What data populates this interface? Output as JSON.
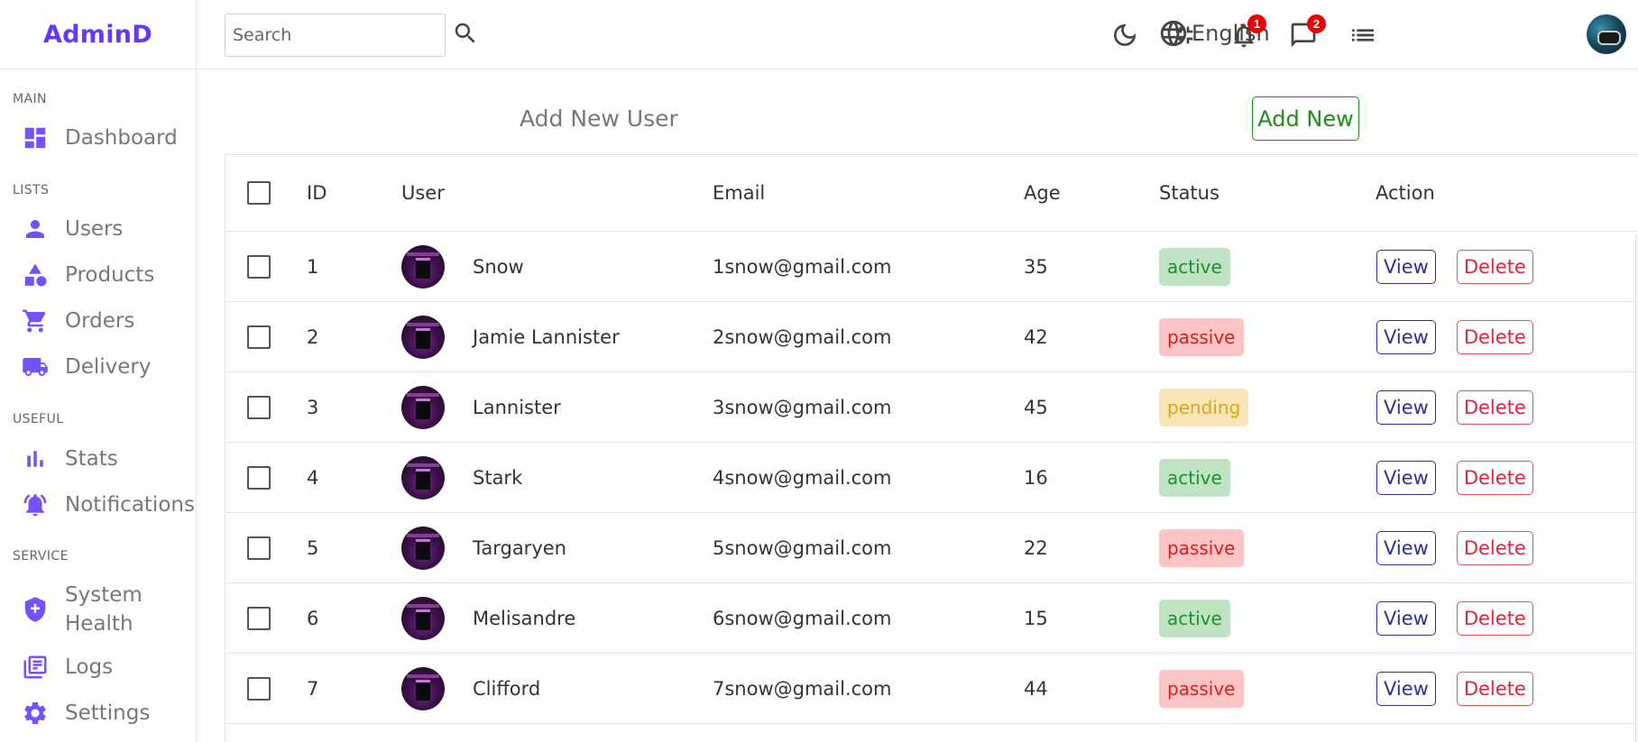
{
  "app": {
    "logo": "AdminD"
  },
  "sidebar": {
    "sections": [
      {
        "title": "MAIN"
      },
      {
        "title": "LISTS"
      },
      {
        "title": "USEFUL"
      },
      {
        "title": "SERVICE"
      }
    ],
    "items": [
      {
        "label": "Dashboard",
        "icon": "dashboard-icon"
      },
      {
        "label": "Users",
        "icon": "person-icon"
      },
      {
        "label": "Products",
        "icon": "category-icon"
      },
      {
        "label": "Orders",
        "icon": "cart-icon"
      },
      {
        "label": "Delivery",
        "icon": "truck-icon"
      },
      {
        "label": "Stats",
        "icon": "bar-chart-icon"
      },
      {
        "label": "Notifications",
        "icon": "bell-ring-icon"
      },
      {
        "label": "System Health",
        "icon": "shield-plus-icon"
      },
      {
        "label": "Logs",
        "icon": "library-books-icon"
      },
      {
        "label": "Settings",
        "icon": "gear-icon"
      }
    ]
  },
  "topbar": {
    "search": {
      "placeholder": "Search",
      "value": ""
    },
    "language": "English",
    "notifications_count": "1",
    "messages_count": "2"
  },
  "main": {
    "add_title": "Add New User",
    "add_button": "Add New"
  },
  "table": {
    "columns": [
      "ID",
      "User",
      "Email",
      "Age",
      "Status",
      "Action"
    ],
    "rows": [
      {
        "id": "1",
        "user": "Snow",
        "email": "1snow@gmail.com",
        "age": "35",
        "status": "active"
      },
      {
        "id": "2",
        "user": "Jamie Lannister",
        "email": "2snow@gmail.com",
        "age": "42",
        "status": "passive"
      },
      {
        "id": "3",
        "user": "Lannister",
        "email": "3snow@gmail.com",
        "age": "45",
        "status": "pending"
      },
      {
        "id": "4",
        "user": "Stark",
        "email": "4snow@gmail.com",
        "age": "16",
        "status": "active"
      },
      {
        "id": "5",
        "user": "Targaryen",
        "email": "5snow@gmail.com",
        "age": "22",
        "status": "passive"
      },
      {
        "id": "6",
        "user": "Melisandre",
        "email": "6snow@gmail.com",
        "age": "15",
        "status": "active"
      },
      {
        "id": "7",
        "user": "Clifford",
        "email": "7snow@gmail.com",
        "age": "44",
        "status": "passive"
      }
    ],
    "view_label": "View",
    "delete_label": "Delete"
  },
  "colors": {
    "brand": "#6439ff",
    "sidebar_icon": "#7451f8",
    "active": "#1e8f2e",
    "passive": "#d42020",
    "pending": "#d9a41f",
    "badge": "#ee0000"
  }
}
